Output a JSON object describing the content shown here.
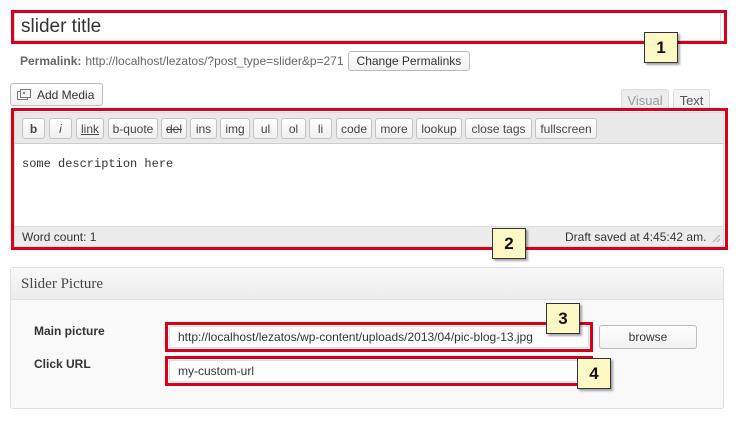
{
  "post": {
    "title_value": "slider title",
    "permalink_label": "Permalink:",
    "permalink_url": "http://localhost/lezatos/?post_type=slider&p=271",
    "change_permalinks_label": "Change Permalinks"
  },
  "media": {
    "add_media_label": "Add Media"
  },
  "editor_tabs": {
    "visual": "Visual",
    "text": "Text"
  },
  "quicktags": [
    "b",
    "i",
    "link",
    "b-quote",
    "del",
    "ins",
    "img",
    "ul",
    "ol",
    "li",
    "code",
    "more",
    "lookup",
    "close tags",
    "fullscreen"
  ],
  "editor": {
    "content": "some description here",
    "word_count": "Word count: 1",
    "draft_saved": "Draft saved at 4:45:42 am."
  },
  "metabox": {
    "title": "Slider Picture",
    "main_picture_label": "Main picture",
    "main_picture_value": "http://localhost/lezatos/wp-content/uploads/2013/04/pic-blog-13.jpg",
    "browse_label": "browse",
    "click_url_label": "Click URL",
    "click_url_value": "my-custom-url"
  },
  "callouts": [
    "1",
    "2",
    "3",
    "4"
  ],
  "colors": {
    "highlight_frame": "#d9001b",
    "callout_fill": "#fdf9c4"
  }
}
